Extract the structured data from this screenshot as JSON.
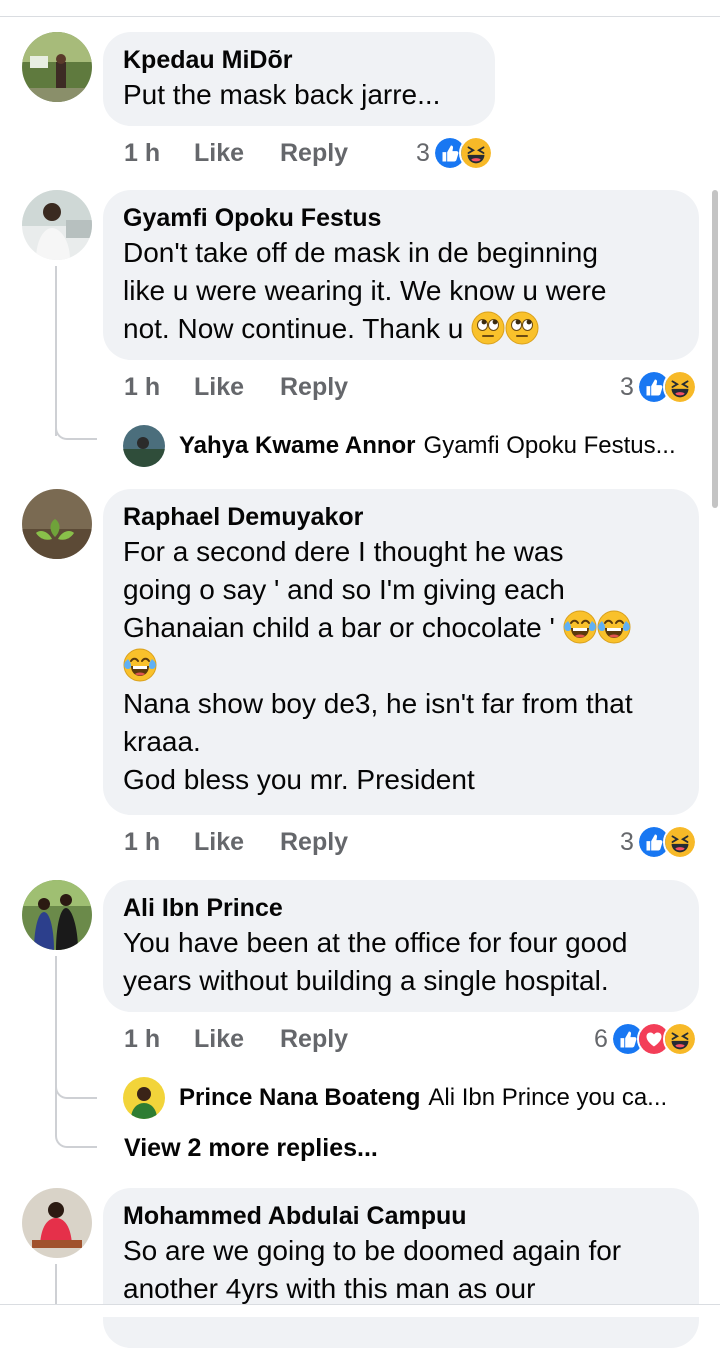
{
  "comments": [
    {
      "author": "Kpedau MiDõr",
      "lines": [
        "Put the mask back jarre..."
      ],
      "time": "1 h",
      "like": "Like",
      "reply": "Reply",
      "reaction_count": "3"
    },
    {
      "author": "Gyamfi Opoku Festus",
      "lines": [
        "Don't take off de mask in de beginning",
        "like u were wearing it. We know u were",
        "not. Now continue. Thank u"
      ],
      "time": "1 h",
      "like": "Like",
      "reply": "Reply",
      "reaction_count": "3",
      "reply_preview": {
        "name": "Yahya Kwame Annor",
        "text": "Gyamfi Opoku Festus..."
      }
    },
    {
      "author": "Raphael Demuyakor",
      "lines": [
        "For a second dere I thought he was",
        "going o say ' and so I'm giving each",
        "Ghanaian child a bar or chocolate '",
        "",
        "Nana show boy de3, he isn't far from that",
        "kraaa.",
        "God bless you mr. President"
      ],
      "time": "1 h",
      "like": "Like",
      "reply": "Reply",
      "reaction_count": "3"
    },
    {
      "author": "Ali Ibn Prince",
      "lines": [
        "You have been at the office for four good",
        "years without building a single hospital."
      ],
      "time": "1 h",
      "like": "Like",
      "reply": "Reply",
      "reaction_count": "6",
      "reply_preview": {
        "name": "Prince Nana Boateng",
        "text": "Ali Ibn Prince you ca..."
      },
      "more_replies": "View 2 more replies..."
    },
    {
      "author": "Mohammed Abdulai Campuu",
      "lines": [
        "So are we going to be doomed again for",
        "another 4yrs with this man as our"
      ]
    }
  ],
  "icons": {
    "like": "like-reaction-icon",
    "haha": "haha-reaction-icon",
    "love": "love-reaction-icon",
    "rolling_eyes": "rolling-eyes-emoji",
    "tears_of_joy": "tears-of-joy-emoji"
  },
  "colors": {
    "bubble": "#f0f2f5",
    "like_blue": "#1877f2",
    "love_red": "#f33e58",
    "haha_yellow": "#f7b928",
    "meta_gray": "#65676b"
  }
}
